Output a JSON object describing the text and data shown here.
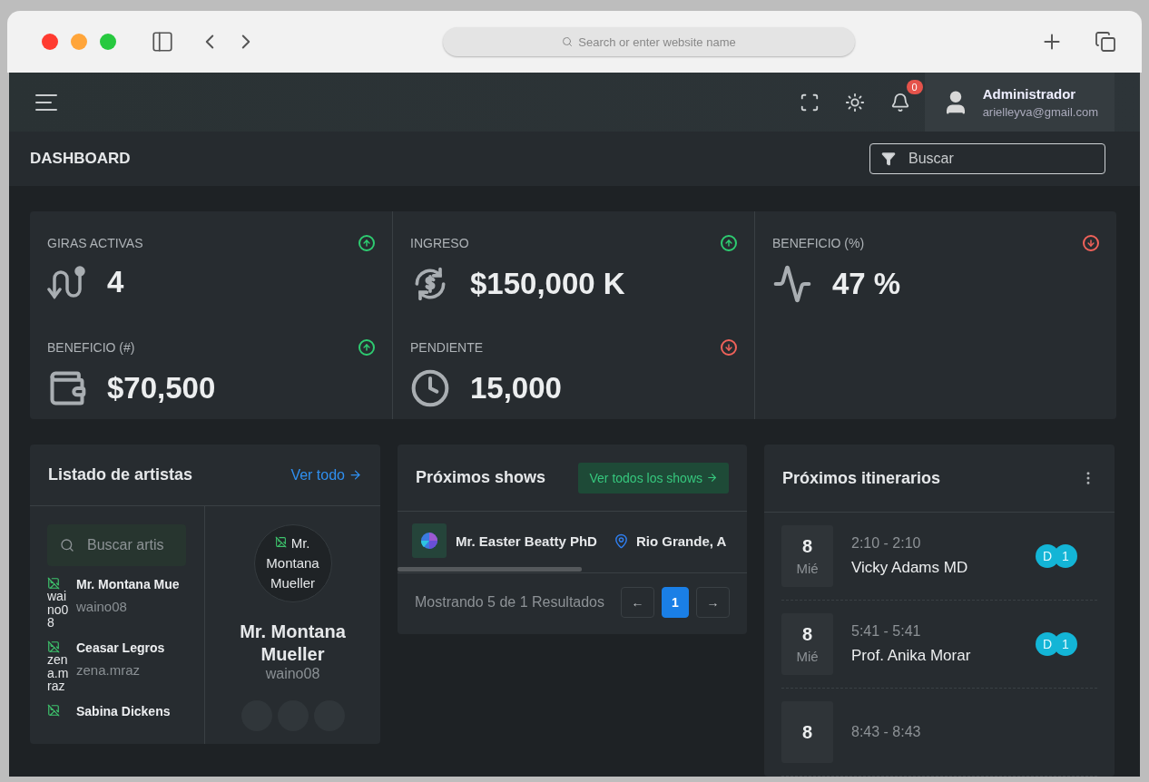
{
  "browser": {
    "address_placeholder": "Search or enter website name"
  },
  "topbar": {
    "notifications": "0",
    "user": {
      "name": "Administrador",
      "email": "arielleyva@gmail.com"
    }
  },
  "header": {
    "title": "DASHBOARD",
    "search_placeholder": "Buscar"
  },
  "stats": [
    {
      "label": "GIRAS ACTIVAS",
      "value": "4",
      "trend_up": true
    },
    {
      "label": "INGRESO",
      "value": "$150,000 K",
      "trend_up": true
    },
    {
      "label": "BENEFICIO (%)",
      "value": "47 %",
      "trend_up": false
    },
    {
      "label": "BENEFICIO (#)",
      "value": "$70,500",
      "trend_up": true
    },
    {
      "label": "PENDIENTE",
      "value": "15,000",
      "trend_up": false
    }
  ],
  "artists": {
    "title": "Listado de artistas",
    "link": "Ver todo",
    "search_placeholder": "Buscar artis",
    "items": [
      {
        "alt": "waino08",
        "name": "Mr. Montana Mue",
        "username": "waino08"
      },
      {
        "alt": "zena.mraz",
        "name": "Ceasar Legros",
        "username": "zena.mraz"
      },
      {
        "name": "Sabina Dickens"
      }
    ],
    "profile": {
      "alt": "Mr. Montana Mueller",
      "name": "Mr. Montana Mueller",
      "username": "waino08"
    }
  },
  "shows": {
    "title": "Próximos shows",
    "link": "Ver todos los shows",
    "rows": [
      {
        "name": "Mr. Easter Beatty PhD",
        "location": "Rio Grande, A"
      }
    ],
    "summary": "Mostrando 5 de 1 Resultados",
    "pagination": [
      {
        "label": "←",
        "kind": "prev",
        "selected": false
      },
      {
        "label": "1",
        "kind": "page",
        "selected": true
      },
      {
        "label": "→",
        "kind": "next",
        "selected": false
      }
    ]
  },
  "itineraries": {
    "title": "Próximos itinerarios",
    "items": [
      {
        "day": "8",
        "weekday": "Mié",
        "time": "2:10 - 2:10",
        "name": "Vicky Adams MD",
        "badges": [
          "D",
          "1"
        ]
      },
      {
        "day": "8",
        "weekday": "Mié",
        "time": "5:41 - 5:41",
        "name": "Prof. Anika Morar",
        "badges": [
          "D",
          "1"
        ]
      },
      {
        "day": "8",
        "time": "8:43 - 8:43"
      }
    ]
  }
}
